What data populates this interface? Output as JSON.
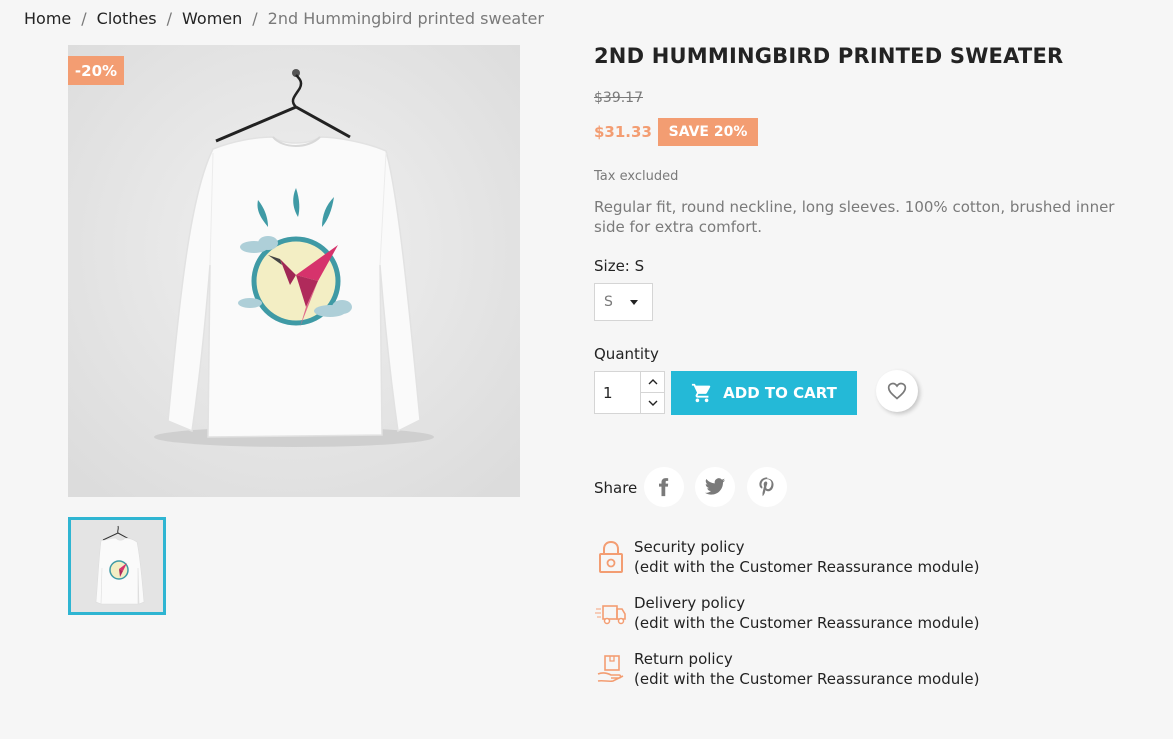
{
  "breadcrumb": {
    "home": "Home",
    "sep": "/",
    "clothes": "Clothes",
    "women": "Women",
    "current": "2nd Hummingbird printed sweater"
  },
  "product": {
    "discount_flag": "-20%",
    "title": "2ND HUMMINGBIRD PRINTED SWEATER",
    "old_price": "$39.17",
    "price": "$31.33",
    "save_badge": "SAVE 20%",
    "tax": "Tax excluded",
    "description": "Regular fit, round neckline, long sleeves. 100% cotton, brushed inner side for extra comfort."
  },
  "variants": {
    "size_label": "Size: S",
    "size_value": "S"
  },
  "cart": {
    "quantity_label": "Quantity",
    "quantity_value": "1",
    "add_to_cart": "ADD TO CART"
  },
  "share": {
    "label": "Share",
    "networks": [
      "facebook-icon",
      "twitter-icon",
      "pinterest-icon"
    ]
  },
  "reassurance": [
    {
      "icon": "lock-icon",
      "title": "Security policy",
      "subtitle": "(edit with the Customer Reassurance module)"
    },
    {
      "icon": "truck-icon",
      "title": "Delivery policy",
      "subtitle": "(edit with the Customer Reassurance module)"
    },
    {
      "icon": "return-icon",
      "title": "Return policy",
      "subtitle": "(edit with the Customer Reassurance module)"
    }
  ],
  "colors": {
    "accent": "#24b9d7",
    "discount": "#f39d72",
    "muted": "#7a7a7a"
  }
}
